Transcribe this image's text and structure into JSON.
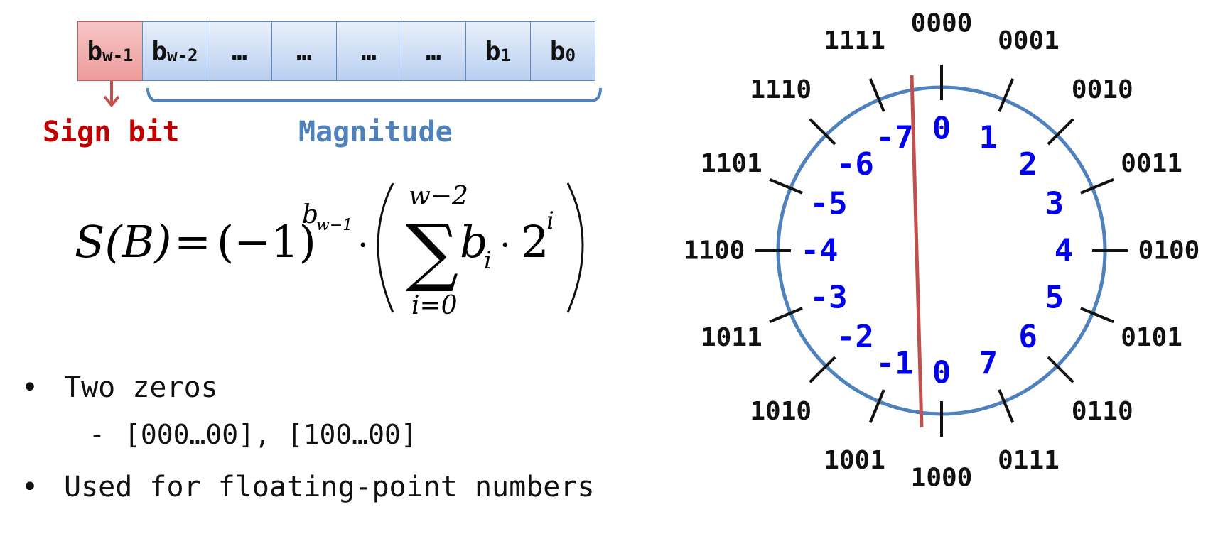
{
  "bit_cells": [
    {
      "base": "b",
      "sub": "w-1"
    },
    {
      "base": "b",
      "sub": "w-2"
    },
    {
      "base": "…",
      "sub": ""
    },
    {
      "base": "…",
      "sub": ""
    },
    {
      "base": "…",
      "sub": ""
    },
    {
      "base": "…",
      "sub": ""
    },
    {
      "base": "b",
      "sub": "1"
    },
    {
      "base": "b",
      "sub": "0"
    }
  ],
  "labels": {
    "sign": "Sign bit",
    "magnitude": "Magnitude"
  },
  "formula": {
    "lhs": "S(B)",
    "equals": "=",
    "neg_one": "(−1)",
    "exp_base": "b",
    "exp_sub": "w−1",
    "dot": "·",
    "sum_upper": "w−2",
    "sum_symbol": "∑",
    "sum_lower": "i=0",
    "term_base": "b",
    "term_sub": "i",
    "two": "2",
    "two_exp": "i"
  },
  "bullets": {
    "b1": "Two zeros",
    "b1_sub": "[000…00], [100…00]",
    "b2": "Used for floating-point numbers",
    "dot": "•",
    "dash": "-"
  },
  "wheel": {
    "codes": [
      "0000",
      "0001",
      "0010",
      "0011",
      "0100",
      "0101",
      "0110",
      "0111",
      "1000",
      "1001",
      "1010",
      "1011",
      "1100",
      "1101",
      "1110",
      "1111"
    ],
    "values": [
      "0",
      "1",
      "2",
      "3",
      "4",
      "5",
      "6",
      "7",
      "0",
      "-1",
      "-2",
      "-3",
      "-4",
      "-5",
      "-6",
      "-7"
    ],
    "colors": {
      "circle": "#4f81bd",
      "divider": "#c0504d",
      "values": "#0000ee",
      "codes": "#111111"
    }
  }
}
